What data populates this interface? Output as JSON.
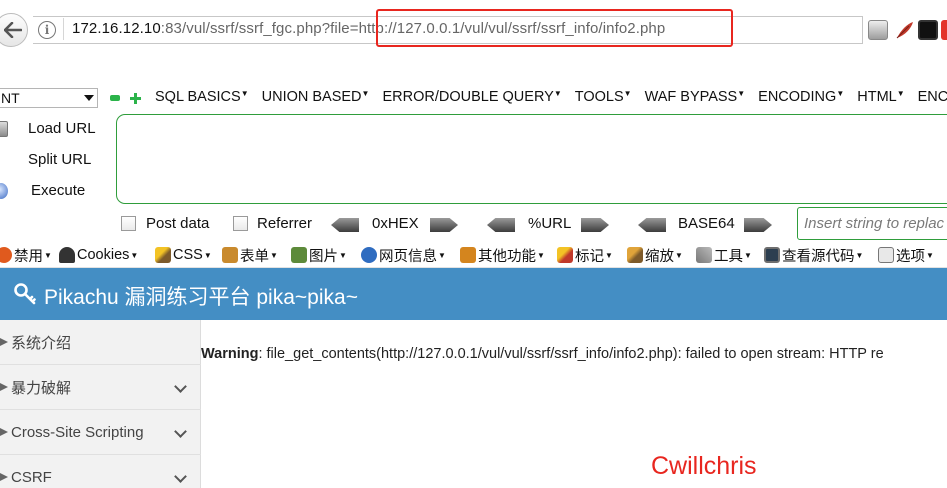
{
  "address_bar": {
    "host": "172.16.12.10",
    "path": ":83/vul/ssrf/ssrf_fgc.php?file=",
    "highlighted_param": "http://127.0.0.1/vul/vul/ssrf/ssrf_info/info2.php"
  },
  "hackbar": {
    "select_value": "NT",
    "menus": [
      "SQL BASICS",
      "UNION BASED",
      "ERROR/DOUBLE QUERY",
      "TOOLS",
      "WAF BYPASS",
      "ENCODING",
      "HTML",
      "ENC"
    ],
    "actions": {
      "load": "Load URL",
      "split": "Split URL",
      "execute": "Execute"
    },
    "post_data_label": "Post data",
    "referrer_label": "Referrer",
    "hex_label": "0xHEX",
    "url_label": "%URL",
    "base64_label": "BASE64",
    "insert_placeholder": "Insert string to replac"
  },
  "dev_toolbar": {
    "items": [
      "禁用",
      "Cookies",
      "CSS",
      "表单",
      "图片",
      "网页信息",
      "其他功能",
      "标记",
      "缩放",
      "工具",
      "查看源代码",
      "选项"
    ]
  },
  "site": {
    "title": "Pikachu 漏洞练习平台 pika~pika~"
  },
  "sidebar": {
    "items": [
      "系统介绍",
      "暴力破解",
      "Cross-Site Scripting",
      "CSRF"
    ]
  },
  "content": {
    "warning_label": "Warning",
    "warning_text": ": file_get_contents(http://127.0.0.1/vul/vul/ssrf/ssrf_info/info2.php): failed to open stream: HTTP re",
    "watermark": "Cwillchris"
  },
  "colors": {
    "header_blue": "#448ec4",
    "highlight_red": "#e8261f",
    "hackbar_green": "#2f9d3b"
  }
}
